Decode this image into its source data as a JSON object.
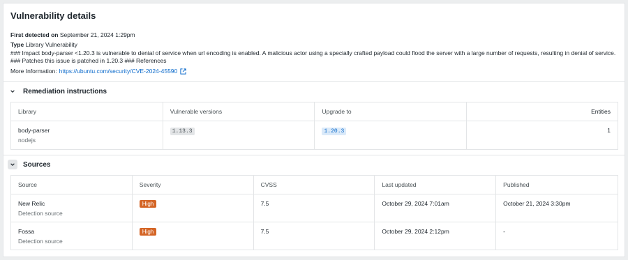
{
  "title": "Vulnerability details",
  "first_detected": {
    "label": "First detected on",
    "value": "September 21, 2024 1:29pm"
  },
  "type": {
    "label": "Type",
    "value": "Library Vulnerability"
  },
  "description": "### Impact body-parser <1.20.3 is vulnerable to denial of service when url encoding is enabled. A malicious actor using a specially crafted payload could flood the server with a large number of requests, resulting in denial of service. ### Patches this issue is patched in 1.20.3 ### References",
  "more_info": {
    "label": "More Information:",
    "link": "https://ubuntu.com/security/CVE-2024-45590",
    "icon": "external-link-icon"
  },
  "remediation": {
    "heading": "Remediation instructions",
    "columns": {
      "library": "Library",
      "vulnerable": "Vulnerable versions",
      "upgrade": "Upgrade to",
      "entities": "Entities"
    },
    "rows": [
      {
        "library": "body-parser",
        "ecosystem": "nodejs",
        "vulnerable": "1.13.3",
        "upgrade": "1.20.3",
        "entities": "1"
      }
    ]
  },
  "sources": {
    "heading": "Sources",
    "columns": {
      "source": "Source",
      "severity": "Severity",
      "cvss": "CVSS",
      "last_updated": "Last updated",
      "published": "Published"
    },
    "rows": [
      {
        "source": "New Relic",
        "type": "Detection source",
        "severity": "High",
        "cvss": "7.5",
        "last_updated": "October 29, 2024 7:01am",
        "published": "October 21, 2024 3:30pm"
      },
      {
        "source": "Fossa",
        "type": "Detection source",
        "severity": "High",
        "cvss": "7.5",
        "last_updated": "October 29, 2024 2:12pm",
        "published": "-"
      }
    ]
  },
  "colors": {
    "link": "#0b6acb",
    "severity_high": "#d46526",
    "border": "#e3e5e7",
    "background": "#eceeef"
  }
}
